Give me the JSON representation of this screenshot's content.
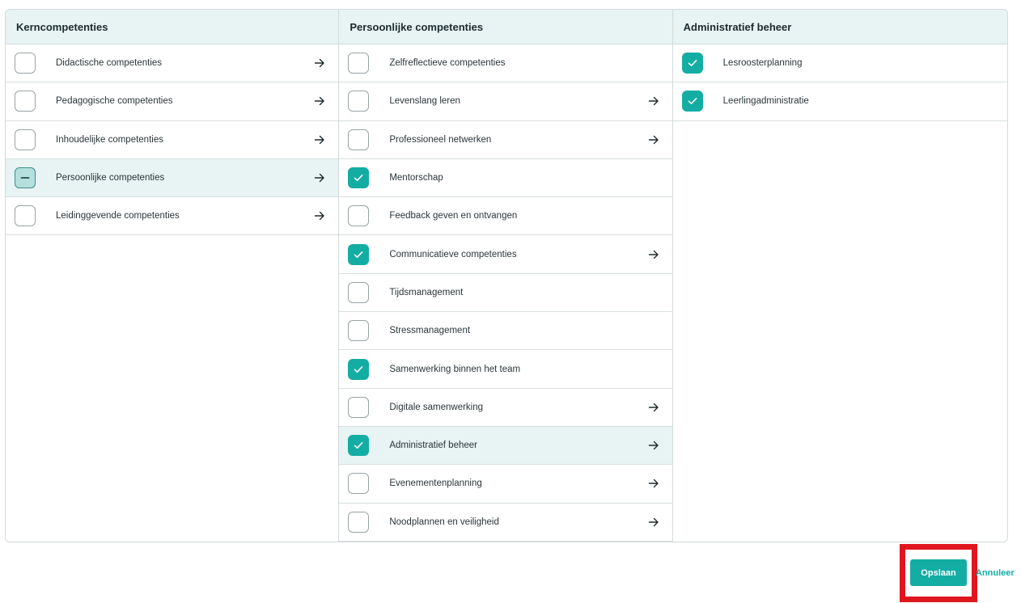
{
  "columns": [
    {
      "title": "Kerncompetenties",
      "items": [
        {
          "label": "Didactische competenties",
          "state": "unchecked",
          "arrow": true,
          "active": false
        },
        {
          "label": "Pedagogische competenties",
          "state": "unchecked",
          "arrow": true,
          "active": false
        },
        {
          "label": "Inhoudelijke competenties",
          "state": "unchecked",
          "arrow": true,
          "active": false
        },
        {
          "label": "Persoonlijke competenties",
          "state": "partial",
          "arrow": true,
          "active": true
        },
        {
          "label": "Leidinggevende competenties",
          "state": "unchecked",
          "arrow": true,
          "active": false
        }
      ]
    },
    {
      "title": "Persoonlijke competenties",
      "items": [
        {
          "label": "Zelfreflectieve competenties",
          "state": "unchecked",
          "arrow": false,
          "active": false
        },
        {
          "label": "Levenslang leren",
          "state": "unchecked",
          "arrow": true,
          "active": false
        },
        {
          "label": "Professioneel netwerken",
          "state": "unchecked",
          "arrow": true,
          "active": false
        },
        {
          "label": "Mentorschap",
          "state": "checked",
          "arrow": false,
          "active": false
        },
        {
          "label": "Feedback geven en ontvangen",
          "state": "unchecked",
          "arrow": false,
          "active": false
        },
        {
          "label": "Communicatieve competenties",
          "state": "checked",
          "arrow": true,
          "active": false
        },
        {
          "label": "Tijdsmanagement",
          "state": "unchecked",
          "arrow": false,
          "active": false
        },
        {
          "label": "Stressmanagement",
          "state": "unchecked",
          "arrow": false,
          "active": false
        },
        {
          "label": "Samenwerking binnen het team",
          "state": "checked",
          "arrow": false,
          "active": false
        },
        {
          "label": "Digitale samenwerking",
          "state": "unchecked",
          "arrow": true,
          "active": false
        },
        {
          "label": "Administratief beheer",
          "state": "checked",
          "arrow": true,
          "active": true
        },
        {
          "label": "Evenementenplanning",
          "state": "unchecked",
          "arrow": true,
          "active": false
        },
        {
          "label": "Noodplannen en veiligheid",
          "state": "unchecked",
          "arrow": true,
          "active": false
        }
      ]
    },
    {
      "title": "Administratief beheer",
      "items": [
        {
          "label": "Lesroosterplanning",
          "state": "checked",
          "arrow": false,
          "active": false
        },
        {
          "label": "Leerlingadministratie",
          "state": "checked",
          "arrow": false,
          "active": false
        }
      ]
    }
  ],
  "actions": {
    "save_label": "Opslaan",
    "cancel_label": "Annuleer"
  },
  "colors": {
    "accent": "#13ada4",
    "highlight_border": "#e0161f",
    "header_bg": "#e8f3f3"
  },
  "icons": {
    "check": "check-icon",
    "partial": "minus-icon",
    "navigate": "arrow-right-icon"
  }
}
